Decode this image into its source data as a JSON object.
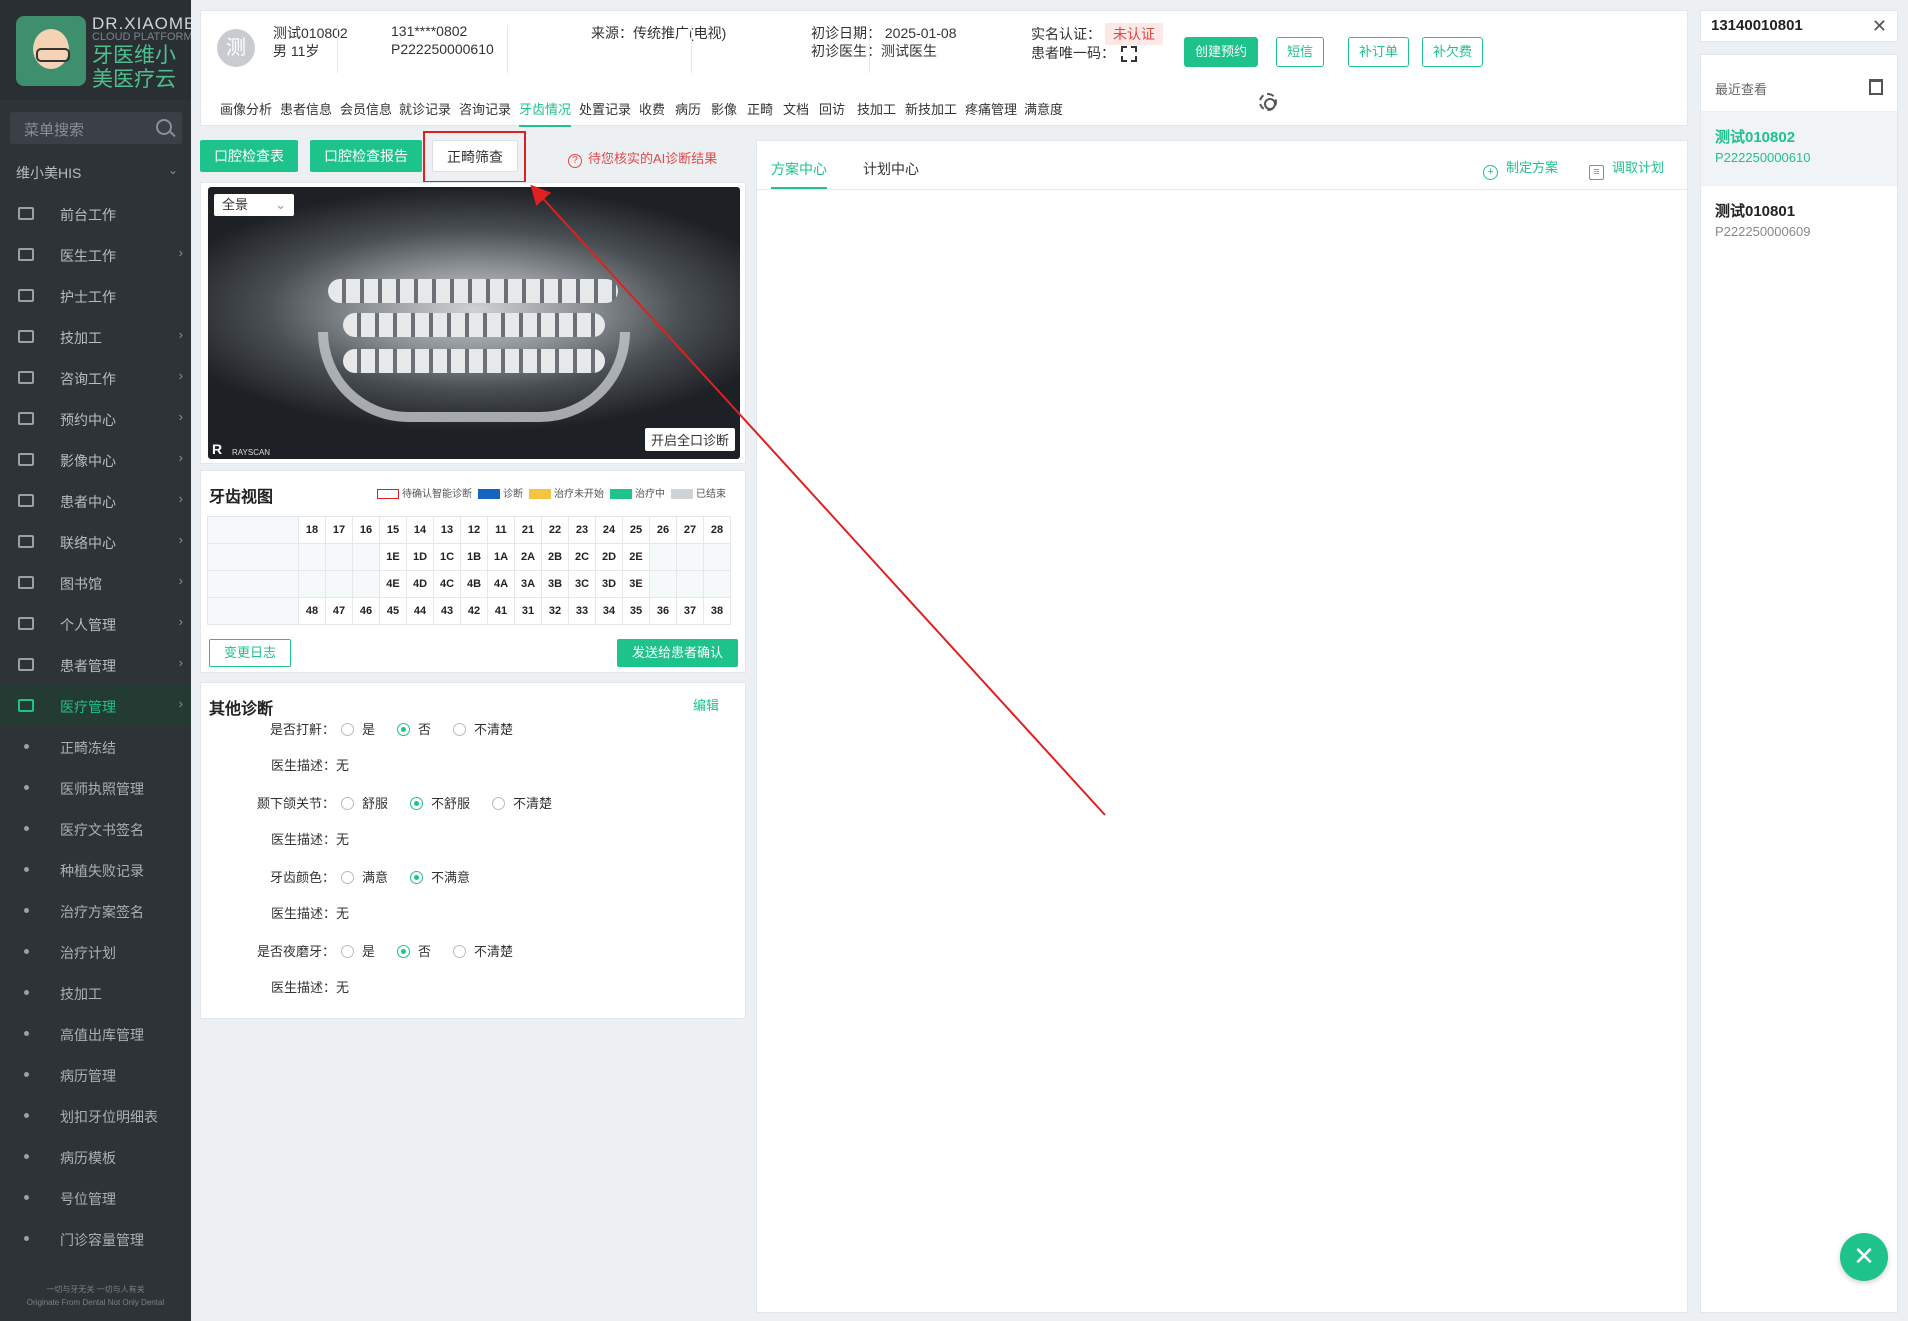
{
  "sidebar": {
    "logo_en": "DR.XIAOMEI",
    "logo_sub": "CLOUD PLATFORM",
    "logo_cn": "牙医维小美医疗云",
    "search_placeholder": "菜单搜索",
    "section_title": "维小美HIS",
    "items": [
      {
        "label": "前台工作",
        "icon": "monitor-icon",
        "arrow": false
      },
      {
        "label": "医生工作",
        "icon": "medical-kit-icon",
        "arrow": true
      },
      {
        "label": "护士工作",
        "icon": "monitor-icon",
        "arrow": false
      },
      {
        "label": "技加工",
        "icon": "tool-icon",
        "arrow": true
      },
      {
        "label": "咨询工作",
        "icon": "headset-icon",
        "arrow": true
      },
      {
        "label": "预约中心",
        "icon": "clock-icon",
        "arrow": true
      },
      {
        "label": "影像中心",
        "icon": "image-icon",
        "arrow": true
      },
      {
        "label": "患者中心",
        "icon": "patient-icon",
        "arrow": true
      },
      {
        "label": "联络中心",
        "icon": "contact-icon",
        "arrow": true
      },
      {
        "label": "图书馆",
        "icon": "library-icon",
        "arrow": true
      },
      {
        "label": "个人管理",
        "icon": "user-icon",
        "arrow": true
      },
      {
        "label": "患者管理",
        "icon": "add-user-icon",
        "arrow": true
      },
      {
        "label": "医疗管理",
        "icon": "clipboard-icon",
        "arrow": true,
        "active": true
      }
    ],
    "sub_items": [
      "正畸冻结",
      "医师执照管理",
      "医疗文书签名",
      "种植失败记录",
      "治疗方案签名",
      "治疗计划",
      "技加工",
      "高值出库管理",
      "病历管理",
      "划扣牙位明细表",
      "病历模板",
      "号位管理",
      "门诊容量管理"
    ],
    "slogan_cn": "一切与牙无关 一切与人有关",
    "slogan_en": "Originate From Dental Not Only Dental"
  },
  "patient": {
    "avatar_char": "测",
    "name": "测试010802",
    "gender_age": "男 11岁",
    "phone": "131****0802",
    "patient_id": "P222250000610",
    "source": "来源：传统推广(电视)",
    "first_visit_date": "初诊日期：  2025-01-08",
    "first_visit_doctor": "初诊医生：测试医生",
    "verify_label": "实名认证：",
    "verify_status": "未认证",
    "unique_code_label": "患者唯一码："
  },
  "header_buttons": [
    "创建预约",
    "短信",
    "补订单",
    "补欠费"
  ],
  "tabs": [
    "画像分析",
    "患者信息",
    "会员信息",
    "就诊记录",
    "咨询记录",
    "牙齿情况",
    "处置记录",
    "收费",
    "病历",
    "影像",
    "正畸",
    "文档",
    "回访",
    "技加工",
    "新技加工",
    "疼痛管理",
    "满意度"
  ],
  "active_tab": "牙齿情况",
  "action_buttons": [
    "口腔检查表",
    "口腔检查报告",
    "正畸筛查"
  ],
  "ai_note": "待您核实的AI诊断结果",
  "xray": {
    "view_select": "全景",
    "rayscan_brand": "RAYSCAN",
    "r_mark": "R",
    "full_diagnosis_button": "开启全口诊断"
  },
  "tooth_chart": {
    "title": "牙齿视图",
    "legend": [
      {
        "label": "待确认智能诊断",
        "color": "#ffffff",
        "border": "#e02020"
      },
      {
        "label": "诊断",
        "color": "#1565c0"
      },
      {
        "label": "治疗未开始",
        "color": "#f5c542"
      },
      {
        "label": "治疗中",
        "color": "#1ec28b"
      },
      {
        "label": "已结束",
        "color": "#cfd3d6"
      }
    ],
    "rows": [
      [
        "18",
        "17",
        "16",
        "15",
        "14",
        "13",
        "12",
        "11",
        "21",
        "22",
        "23",
        "24",
        "25",
        "26",
        "27",
        "28"
      ],
      [
        "",
        "",
        "",
        "1E",
        "1D",
        "1C",
        "1B",
        "1A",
        "2A",
        "2B",
        "2C",
        "2D",
        "2E",
        "",
        "",
        ""
      ],
      [
        "",
        "",
        "",
        "4E",
        "4D",
        "4C",
        "4B",
        "4A",
        "3A",
        "3B",
        "3C",
        "3D",
        "3E",
        "",
        "",
        ""
      ],
      [
        "48",
        "47",
        "46",
        "45",
        "44",
        "43",
        "42",
        "41",
        "31",
        "32",
        "33",
        "34",
        "35",
        "36",
        "37",
        "38"
      ]
    ],
    "change_log_button": "变更日志",
    "send_button": "发送给患者确认"
  },
  "other_diagnosis": {
    "title": "其他诊断",
    "edit_link": "编辑",
    "questions": [
      {
        "label": "是否打鼾：",
        "options": [
          "是",
          "否",
          "不清楚"
        ],
        "selected": 1,
        "desc_label": "医生描述：",
        "desc": "无"
      },
      {
        "label": "颞下颌关节：",
        "options": [
          "舒服",
          "不舒服",
          "不清楚"
        ],
        "selected": 1,
        "desc_label": "医生描述：",
        "desc": "无"
      },
      {
        "label": "牙齿颜色：",
        "options": [
          "满意",
          "不满意"
        ],
        "selected": 1,
        "desc_label": "医生描述：",
        "desc": "无"
      },
      {
        "label": "是否夜磨牙：",
        "options": [
          "是",
          "否",
          "不清楚"
        ],
        "selected": 1,
        "desc_label": "医生描述：",
        "desc": "无"
      }
    ]
  },
  "plan_panel": {
    "tabs": [
      "方案中心",
      "计划中心"
    ],
    "make_plan": "制定方案",
    "fetch_plan": "调取计划"
  },
  "right_panel": {
    "search_value": "13140010801",
    "recent_title": "最近查看",
    "recent": [
      {
        "name": "测试010802",
        "id": "P222250000610",
        "selected": true
      },
      {
        "name": "测试010801",
        "id": "P222250000609",
        "selected": false
      }
    ]
  },
  "colors": {
    "accent": "#1ec28b",
    "sidebar_bg": "#2e3338",
    "alert_red": "#e02020"
  }
}
